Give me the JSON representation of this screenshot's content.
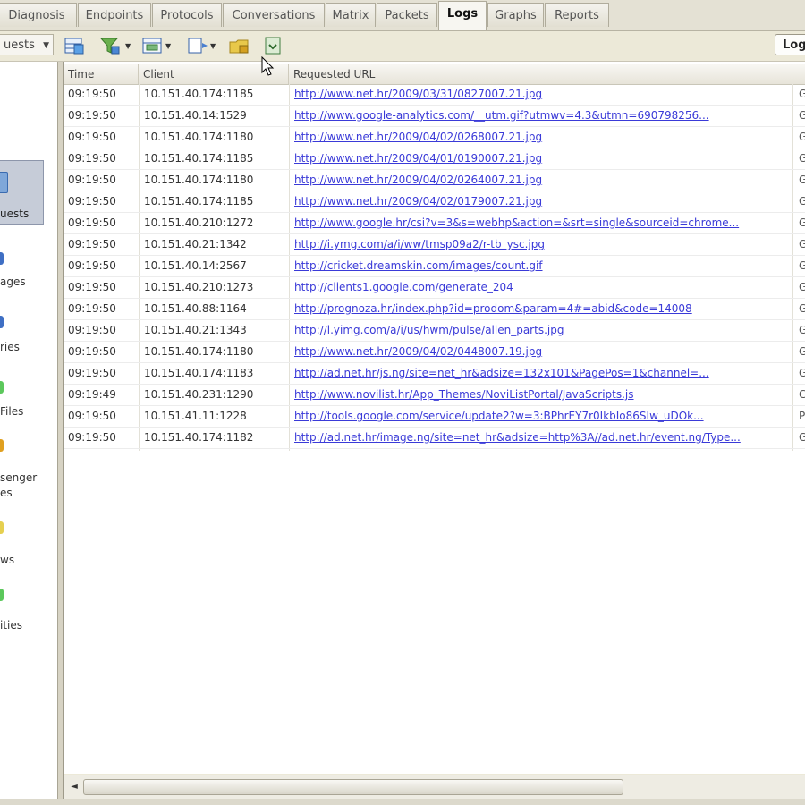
{
  "tabs": [
    {
      "label": "Diagnosis",
      "active": false
    },
    {
      "label": "Endpoints",
      "active": false
    },
    {
      "label": "Protocols",
      "active": false
    },
    {
      "label": "Conversations",
      "active": false
    },
    {
      "label": "Matrix",
      "active": false
    },
    {
      "label": "Packets",
      "active": false
    },
    {
      "label": "Logs",
      "active": true
    },
    {
      "label": "Graphs",
      "active": false
    },
    {
      "label": "Reports",
      "active": false
    }
  ],
  "toolbar": {
    "view_select": "uests",
    "logs_button": "Log",
    "icons": [
      "table-view-icon",
      "filter-icon",
      "columns-icon",
      "export-icon",
      "folder-lock-icon",
      "save-icon"
    ]
  },
  "sidebar": {
    "items": [
      {
        "label": "uests",
        "icon_color": "#7fa7d9"
      },
      {
        "label": "ages",
        "icon_color": "#3f6fc4"
      },
      {
        "label": "ries",
        "icon_color": "#3f6fc4"
      },
      {
        "label": "Files",
        "icon_color": "#5cc85c"
      },
      {
        "label": "senger",
        "label2": "es",
        "icon_color": "#e0a020"
      },
      {
        "label": "ws",
        "icon_color": "#e6d050"
      },
      {
        "label": "ities",
        "icon_color": "#5cc85c"
      }
    ]
  },
  "grid": {
    "columns": [
      "Time",
      "Client",
      "Requested URL"
    ],
    "rows": [
      {
        "time": "09:19:50",
        "client": "10.151.40.174:1185",
        "url": "http://www.net.hr/2009/03/31/0827007.21.jpg",
        "extra": "G"
      },
      {
        "time": "09:19:50",
        "client": "10.151.40.14:1529",
        "url": "http://www.google-analytics.com/__utm.gif?utmwv=4.3&utmn=690798256...",
        "extra": "G"
      },
      {
        "time": "09:19:50",
        "client": "10.151.40.174:1180",
        "url": "http://www.net.hr/2009/04/02/0268007.21.jpg",
        "extra": "G"
      },
      {
        "time": "09:19:50",
        "client": "10.151.40.174:1185",
        "url": "http://www.net.hr/2009/04/01/0190007.21.jpg",
        "extra": "G"
      },
      {
        "time": "09:19:50",
        "client": "10.151.40.174:1180",
        "url": "http://www.net.hr/2009/04/02/0264007.21.jpg",
        "extra": "G"
      },
      {
        "time": "09:19:50",
        "client": "10.151.40.174:1185",
        "url": "http://www.net.hr/2009/04/02/0179007.21.jpg",
        "extra": "G"
      },
      {
        "time": "09:19:50",
        "client": "10.151.40.210:1272",
        "url": "http://www.google.hr/csi?v=3&s=webhp&action=&srt=single&sourceid=chrome...",
        "extra": "G"
      },
      {
        "time": "09:19:50",
        "client": "10.151.40.21:1342",
        "url": "http://i.ymg.com/a/i/ww/tmsp09a2/r-tb_ysc.jpg",
        "extra": "G"
      },
      {
        "time": "09:19:50",
        "client": "10.151.40.14:2567",
        "url": "http://cricket.dreamskin.com/images/count.gif",
        "extra": "G"
      },
      {
        "time": "09:19:50",
        "client": "10.151.40.210:1273",
        "url": "http://clients1.google.com/generate_204",
        "extra": "G"
      },
      {
        "time": "09:19:50",
        "client": "10.151.40.88:1164",
        "url": "http://prognoza.hr/index.php?id=prodom&param=4#=abid&code=14008",
        "extra": "G"
      },
      {
        "time": "09:19:50",
        "client": "10.151.40.21:1343",
        "url": "http://l.yimg.com/a/i/us/hwm/pulse/allen_parts.jpg",
        "extra": "G"
      },
      {
        "time": "09:19:50",
        "client": "10.151.40.174:1180",
        "url": "http://www.net.hr/2009/04/02/0448007.19.jpg",
        "extra": "G"
      },
      {
        "time": "09:19:50",
        "client": "10.151.40.174:1183",
        "url": "http://ad.net.hr/js.ng/site=net_hr&adsize=132x101&PagePos=1&channel=...",
        "extra": "G"
      },
      {
        "time": "09:19:49",
        "client": "10.151.40.231:1290",
        "url": "http://www.novilist.hr/App_Themes/NoviListPortal/JavaScripts.js",
        "extra": "G"
      },
      {
        "time": "09:19:50",
        "client": "10.151.41.11:1228",
        "url": "http://tools.google.com/service/update2?w=3:BPhrEY7r0IkbIo86SIw_uDOk...",
        "extra": "P"
      },
      {
        "time": "09:19:50",
        "client": "10.151.40.174:1182",
        "url": "http://ad.net.hr/image.ng/site=net_hr&adsize=http%3A//ad.net.hr/event.ng/Type...",
        "extra": "G"
      }
    ]
  },
  "scrollbar": {
    "left_arrow": "◄"
  }
}
